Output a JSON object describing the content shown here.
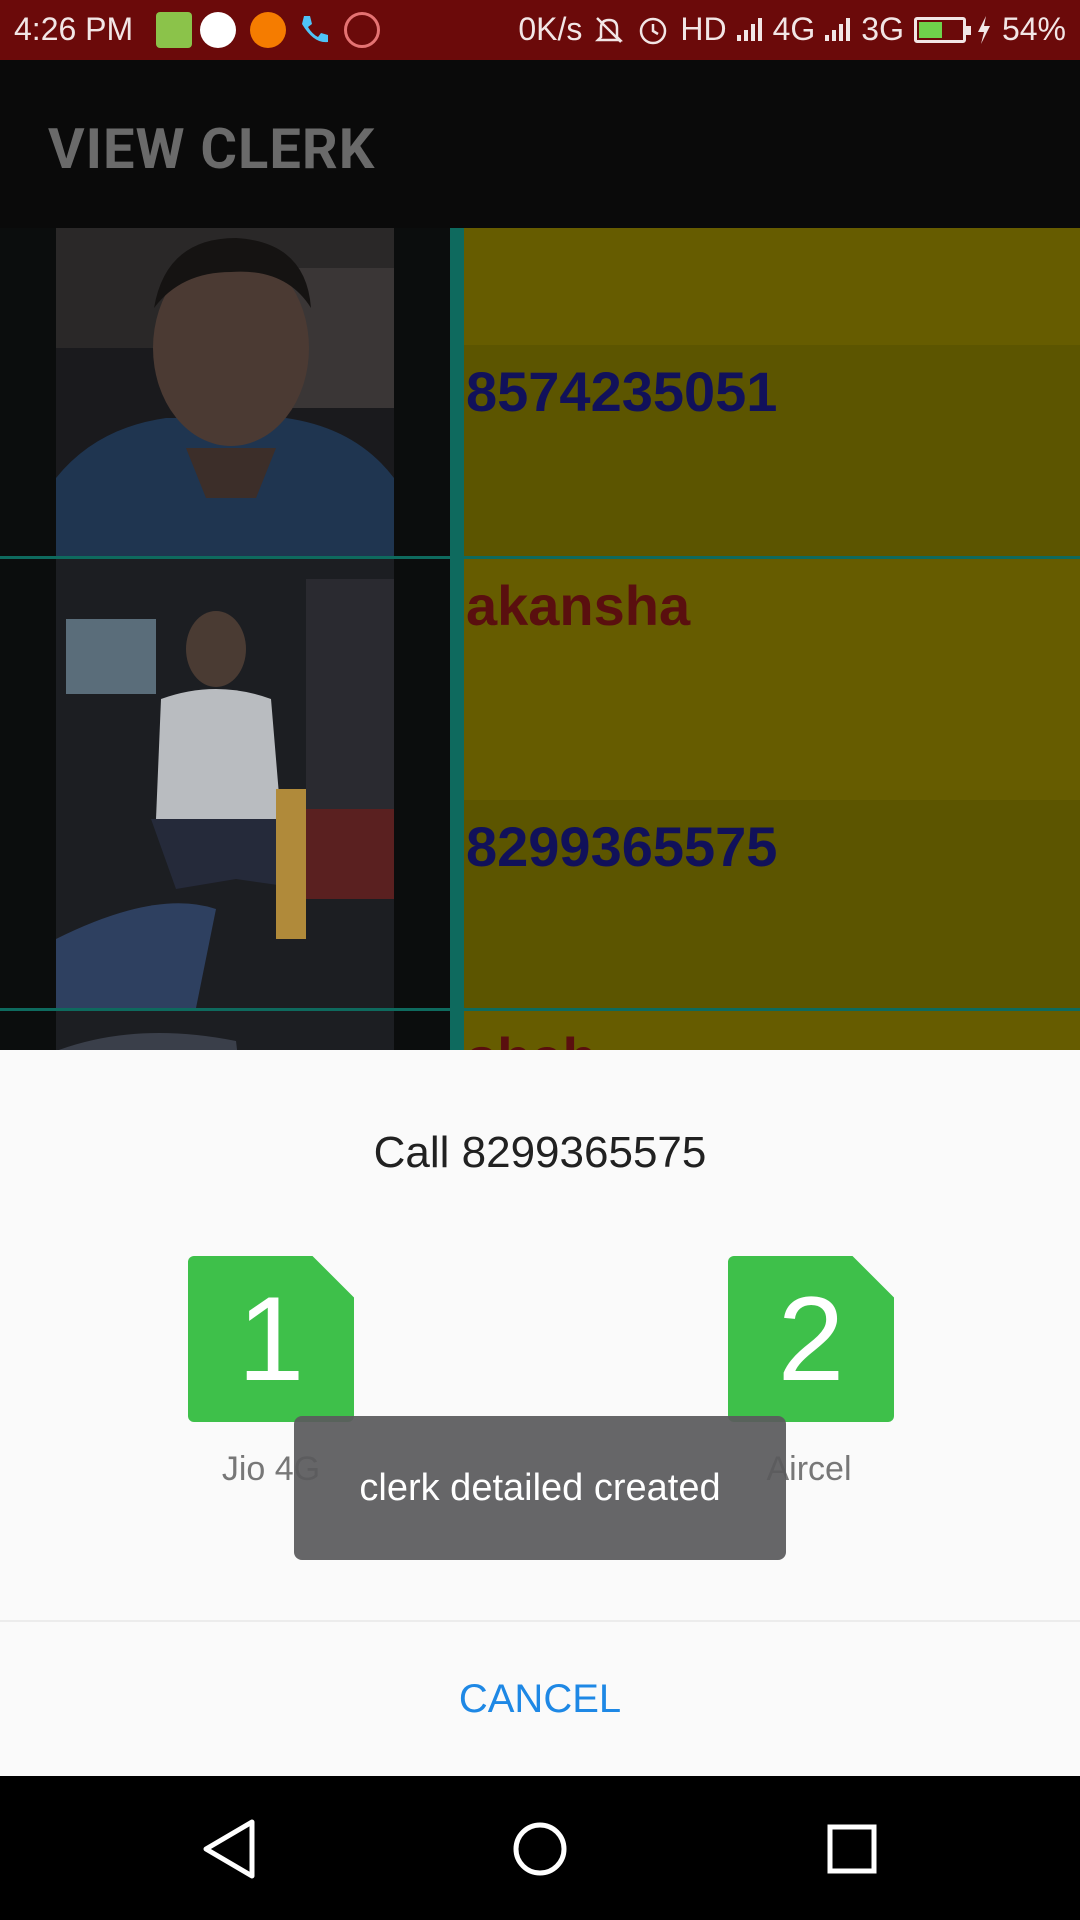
{
  "status_bar": {
    "time": "4:26 PM",
    "net_speed": "0K/s",
    "hd": "HD",
    "net1": "4G",
    "net2": "3G",
    "battery_level": 0.54,
    "battery_text": "54%"
  },
  "header": {
    "title": "VIEW CLERK"
  },
  "list": {
    "rows": [
      {
        "name": "",
        "phone": "8574235051"
      },
      {
        "name": "akansha",
        "phone": "8299365575"
      },
      {
        "name": "shah",
        "phone": ""
      }
    ]
  },
  "dialog": {
    "title": "Call 8299365575",
    "sims": [
      {
        "number": "1",
        "label": "Jio 4G"
      },
      {
        "number": "2",
        "label": "Aircel"
      }
    ],
    "cancel_label": "CANCEL"
  },
  "toast": {
    "message": "clerk detailed created"
  },
  "colors": {
    "status_bar": "#6b0a0a",
    "sim_green": "#3ec04a",
    "accent_blue": "#1e88e5",
    "row_divider": "#0e6a5e"
  }
}
